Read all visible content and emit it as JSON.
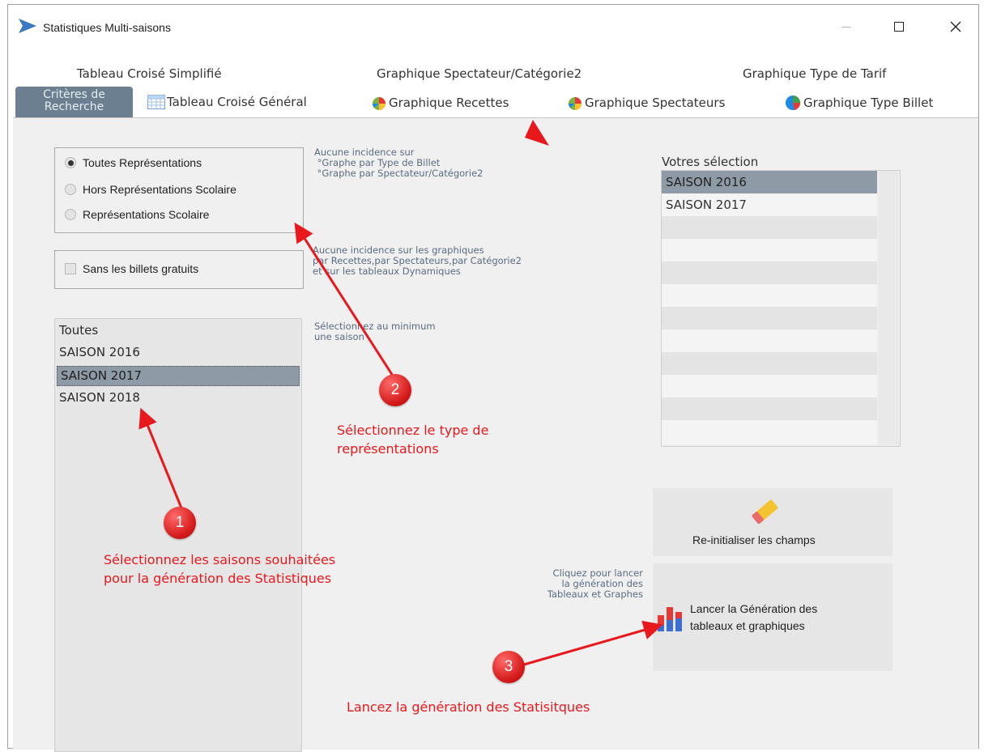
{
  "window": {
    "title": "Statistiques Multi-saisons"
  },
  "tabs_row1": [
    "Tableau Croisé Simplifié",
    "Graphique Spectateur/Catégorie2",
    "Graphique Type de Tarif"
  ],
  "tabs_row2": {
    "active": "Critères de Recherche",
    "items": [
      "Tableau Croisé Général",
      "Graphique Recettes",
      "Graphique Spectateurs",
      "Graphique Type Billet"
    ]
  },
  "representation": {
    "options": [
      "Toutes Représentations",
      "Hors Représentations Scolaire",
      "Représentations Scolaire"
    ],
    "selected": "Toutes Représentations"
  },
  "note_representation": "Aucune incidence sur\n °Graphe par Type de Billet\n °Graphe par Spectateur/Catégorie2",
  "free_tickets": {
    "label": "Sans les billets gratuits",
    "checked": false
  },
  "note_free": "Aucune incidence sur les graphiques\npar Recettes,par Spectateurs,par Catégorie2\net sur les tableaux Dynamiques",
  "season_list": {
    "items": [
      "Toutes",
      "SAISON 2016",
      "SAISON 2017",
      "SAISON 2018"
    ],
    "selected": "SAISON 2017"
  },
  "note_season": "Sélectionnez au minimum\nune saison",
  "selection": {
    "title": "Votres sélection",
    "items": [
      "SAISON 2016",
      "SAISON 2017"
    ],
    "selected": "SAISON 2016"
  },
  "reset_button": {
    "label": "Re-initialiser les champs"
  },
  "launch_hint": "Cliquez pour lancer\nla génération des\nTableaux et Graphes",
  "launch_button": {
    "label": "Lancer la Génération des\ntableaux et graphiques"
  },
  "annotations": {
    "step1": {
      "number": "1",
      "text": "Sélectionnez les saisons souhaitées\npour la génération des Statistiques"
    },
    "step2": {
      "number": "2",
      "text": "Sélectionnez le type de\nreprésentations"
    },
    "step3": {
      "number": "3",
      "text": "Lancez la génération des Statisitques"
    }
  },
  "colors": {
    "annotation": "#e8181d",
    "tab_active": "#6b7f90",
    "list_selected": "#8e9aa6"
  }
}
